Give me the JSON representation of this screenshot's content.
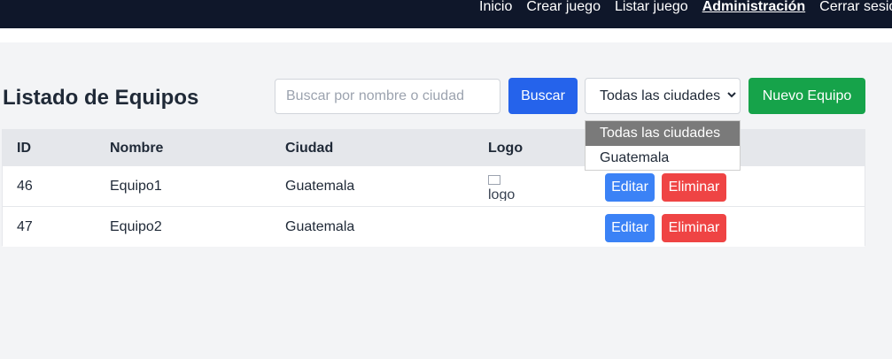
{
  "nav": {
    "items": [
      "Inicio",
      "Crear juego",
      "Listar juego",
      "Administración",
      "Cerrar sesión"
    ],
    "active_index": 3
  },
  "page": {
    "title": "Listado de Equipos"
  },
  "search": {
    "placeholder": "Buscar por nombre o ciudad",
    "value": "",
    "button_label": "Buscar"
  },
  "city_filter": {
    "selected": "Todas las ciudades",
    "options": [
      "Todas las ciudades",
      "Guatemala"
    ],
    "expanded": true
  },
  "new_button_label": "Nuevo Equipo",
  "table": {
    "headers": [
      "ID",
      "Nombre",
      "Ciudad",
      "Logo"
    ],
    "rows": [
      {
        "id": "46",
        "nombre": "Equipo1",
        "ciudad": "Guatemala",
        "logo_alt": "logo",
        "logo_broken": true
      },
      {
        "id": "47",
        "nombre": "Equipo2",
        "ciudad": "Guatemala",
        "logo_alt": "",
        "logo_broken": false
      }
    ],
    "edit_label": "Editar",
    "delete_label": "Eliminar"
  },
  "colors": {
    "topbar": "#0f172a",
    "primary": "#2563eb",
    "success": "#16a34a",
    "edit": "#3b82f6",
    "danger": "#ef4444"
  }
}
